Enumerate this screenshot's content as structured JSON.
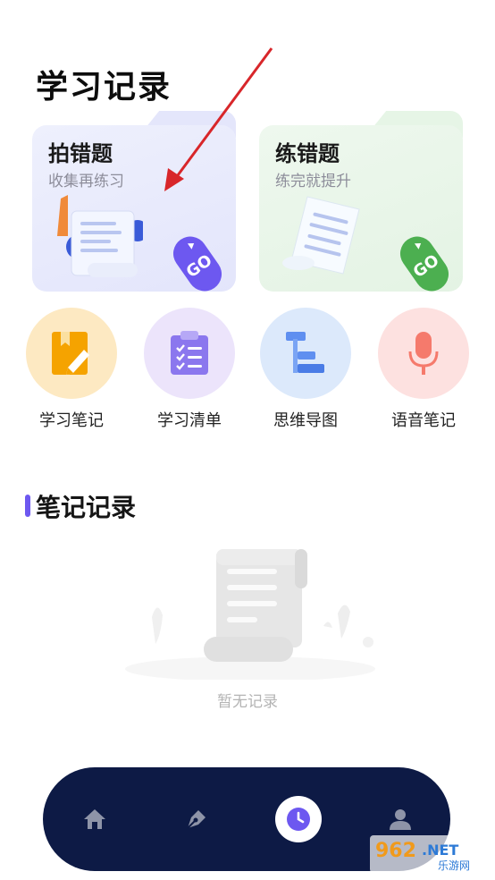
{
  "page": {
    "title": "学习记录"
  },
  "cards": [
    {
      "title": "拍错题",
      "subtitle": "收集再练习",
      "go": "GO",
      "color": "#6d58f0"
    },
    {
      "title": "练错题",
      "subtitle": "练完就提升",
      "go": "GO",
      "color": "#4caf50"
    }
  ],
  "tools": [
    {
      "label": "学习笔记",
      "icon": "notebook-pen-icon",
      "bg": "#fde9c2"
    },
    {
      "label": "学习清单",
      "icon": "clipboard-checklist-icon",
      "bg": "#ece4fb"
    },
    {
      "label": "思维导图",
      "icon": "mind-map-icon",
      "bg": "#dce9fb"
    },
    {
      "label": "语音笔记",
      "icon": "microphone-icon",
      "bg": "#fde1e0"
    }
  ],
  "notes": {
    "title": "笔记记录",
    "empty": "暂无记录"
  },
  "nav": {
    "items": [
      "home-icon",
      "pen-nib-icon",
      "clock-icon",
      "user-icon"
    ],
    "active": 2
  },
  "watermark": {
    "main": "962.NET",
    "sub": "乐游网"
  }
}
